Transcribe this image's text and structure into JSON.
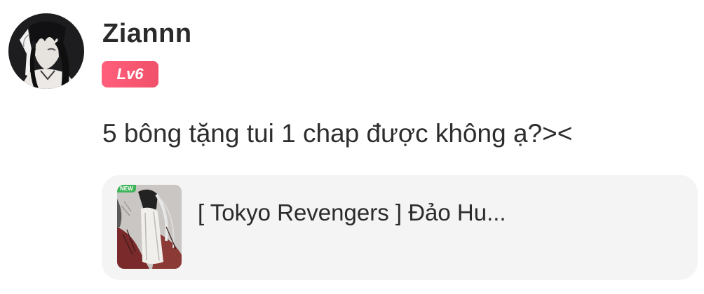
{
  "comment": {
    "author": {
      "name": "Ziannn",
      "level": "Lv6",
      "avatar_icon": "avatar-anime-girl-icon"
    },
    "text": "5 bông tặng tui 1 chap được không ạ?><"
  },
  "story_card": {
    "cover_icon": "manga-cover-icon",
    "badge": "NEW",
    "title": "[ Tokyo Revengers ] Đảo Hu..."
  },
  "colors": {
    "level_badge": "#f0506a",
    "card_bg": "#f4f4f4",
    "new_badge": "#3fb55a",
    "text": "#2b2b2b"
  }
}
